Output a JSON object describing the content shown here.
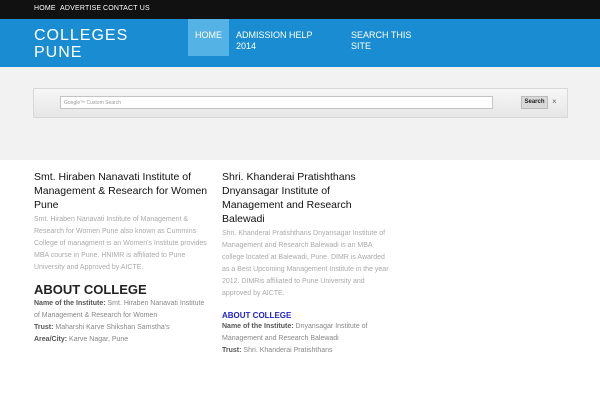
{
  "topbar": {
    "links": [
      "HOME",
      "ADVERTISE",
      "CONTACT US"
    ]
  },
  "header": {
    "logo_line1": "COLLEGES",
    "logo_line2": "PUNE",
    "nav": [
      "HOME",
      "ADMISSION HELP 2014",
      "SEARCH THIS SITE"
    ]
  },
  "search": {
    "placeholder": "Google™ Custom Search",
    "button": "Search",
    "clear": "×"
  },
  "posts": [
    {
      "title": "Smt. Hiraben Nanavati Institute of Management & Research for Women Pune",
      "excerpt": "Smt. Hiraben Nanavati Institute of Management & Research for Women Pune also known as Cummins College of managment is an Women's Institute provides MBA course in Pune. HNIMR is affiliated to Pune University and Approved by AICTE.",
      "about_heading": "ABOUT COLLEGE",
      "fields": [
        {
          "label": "Name of the Institute:",
          "value": "Smt. Hiraben Nanavati Institute of Management & Research for Women"
        },
        {
          "label": "Trust:",
          "value": "Maharshi Karve Shikshan Samstha's"
        },
        {
          "label": "Area/City:",
          "value": "Karve Nagar, Pune"
        }
      ]
    },
    {
      "title": "Shri. Khanderai Pratishthans Dnyansagar Institute of Management and Research Balewadi",
      "excerpt": "Shri. Khanderai Pratishthans Dnyansagar Institute of Management and Research Balewadi is an MBA college located at Balewadi, Pune. DIMR is Awarded as a Best Upcoming Management Institute in the year 2012. DIMRis affiliated to Pune University and approved by AICTE.",
      "about_heading": "ABOUT COLLEGE",
      "fields": [
        {
          "label": "Name of the Institute:",
          "value": "Dnyansagar Institute of Management and Research Balewadi"
        },
        {
          "label": "Trust:",
          "value": "Shri. Khanderai Pratishthans"
        }
      ]
    }
  ]
}
